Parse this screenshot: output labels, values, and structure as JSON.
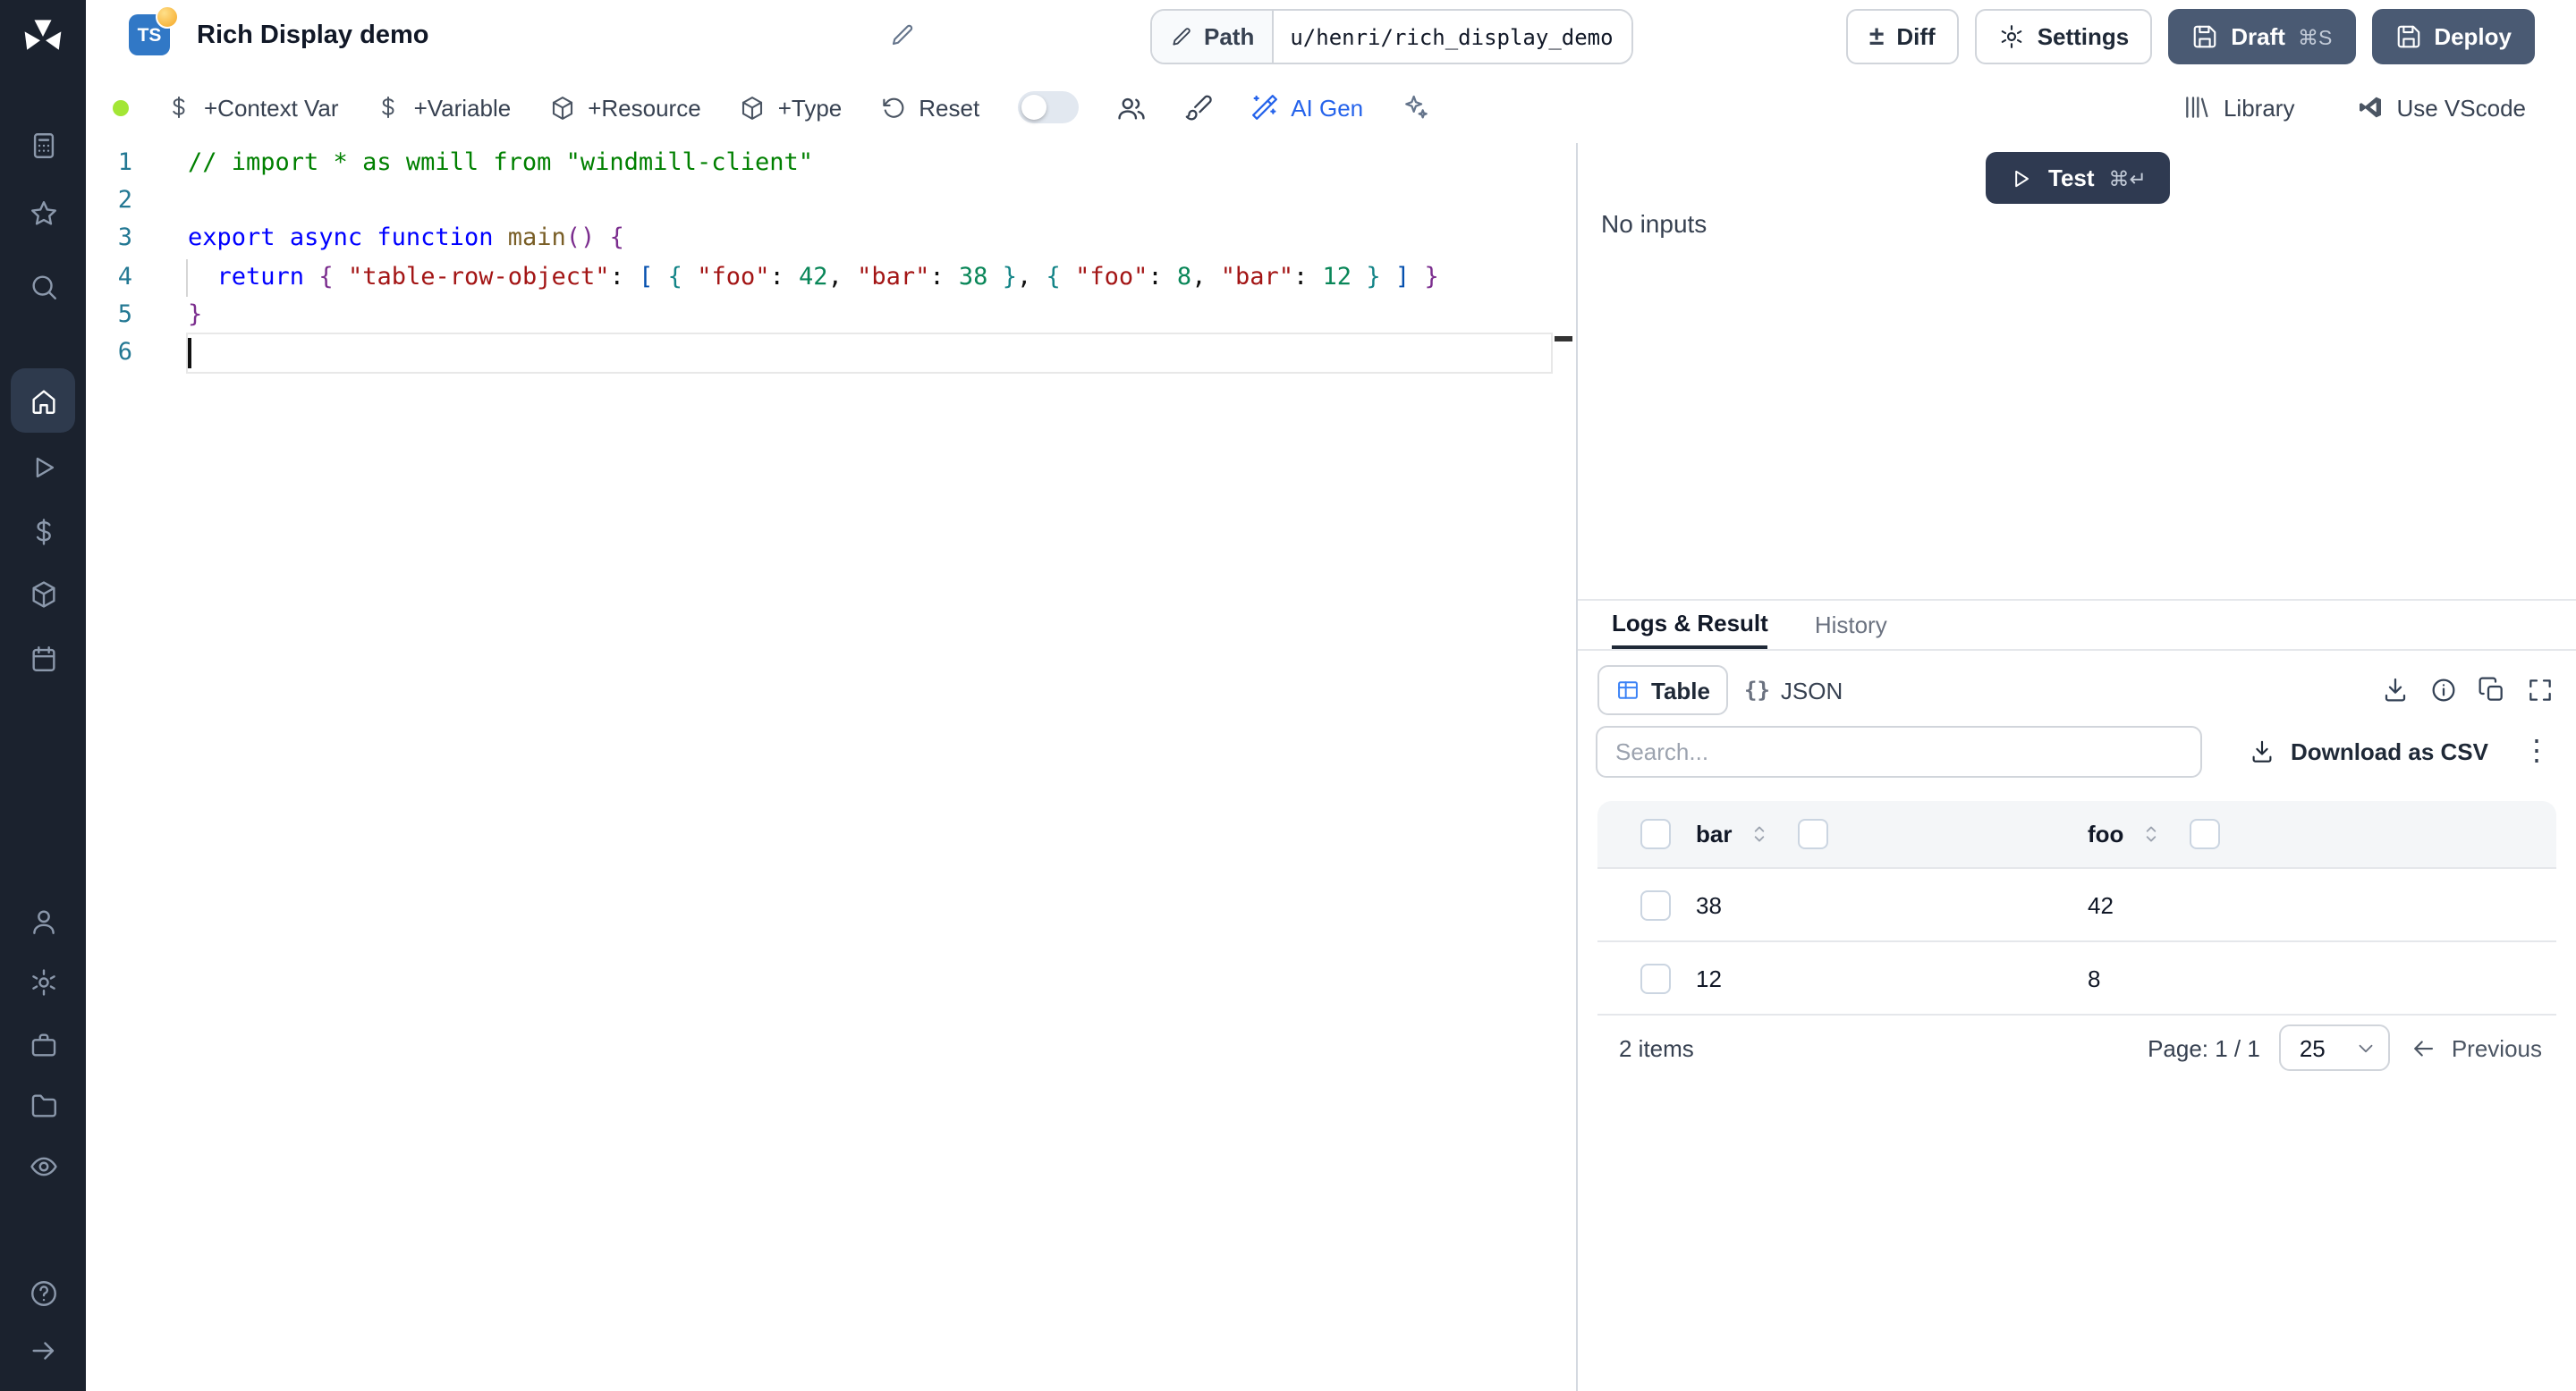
{
  "sidebar": {
    "active_item": "home",
    "icons": [
      "windmill-logo",
      "calculator",
      "star",
      "search",
      "home",
      "play",
      "dollar",
      "boxes",
      "calendar",
      "user",
      "settings",
      "briefcase",
      "folder",
      "eye",
      "help",
      "collapse-arrow"
    ]
  },
  "header": {
    "badge": "TS",
    "title": "Rich Display demo",
    "path_label": "Path",
    "path_value": "u/henri/rich_display_demo",
    "diff_label": "Diff",
    "diff_glyph": "±",
    "settings_label": "Settings",
    "draft_label": "Draft",
    "draft_shortcut": "⌘S",
    "deploy_label": "Deploy"
  },
  "toolbar": {
    "context_var_label": "+Context Var",
    "variable_label": "+Variable",
    "resource_label": "+Resource",
    "type_label": "+Type",
    "reset_label": "Reset",
    "ai_gen_label": "AI Gen",
    "library_label": "Library",
    "vscode_label": "Use VScode"
  },
  "editor": {
    "lines": [
      {
        "num": "1",
        "segments": [
          {
            "c": "comment",
            "t": "// import * as wmill from \"windmill-client\""
          }
        ]
      },
      {
        "num": "2",
        "segments": []
      },
      {
        "num": "3",
        "segments": [
          {
            "c": "kw",
            "t": "export"
          },
          {
            "c": "plain",
            "t": " "
          },
          {
            "c": "kw",
            "t": "async"
          },
          {
            "c": "plain",
            "t": " "
          },
          {
            "c": "kw",
            "t": "function"
          },
          {
            "c": "plain",
            "t": " "
          },
          {
            "c": "fn",
            "t": "main"
          },
          {
            "c": "b1",
            "t": "()"
          },
          {
            "c": "plain",
            "t": " "
          },
          {
            "c": "b1",
            "t": "{"
          }
        ]
      },
      {
        "num": "4",
        "guide": true,
        "segments": [
          {
            "c": "plain",
            "t": "  "
          },
          {
            "c": "kw",
            "t": "return"
          },
          {
            "c": "plain",
            "t": " "
          },
          {
            "c": "b1",
            "t": "{"
          },
          {
            "c": "plain",
            "t": " "
          },
          {
            "c": "str",
            "t": "\"table-row-object\""
          },
          {
            "c": "plain",
            "t": ": "
          },
          {
            "c": "b2",
            "t": "["
          },
          {
            "c": "plain",
            "t": " "
          },
          {
            "c": "b3",
            "t": "{"
          },
          {
            "c": "plain",
            "t": " "
          },
          {
            "c": "str",
            "t": "\"foo\""
          },
          {
            "c": "plain",
            "t": ": "
          },
          {
            "c": "num",
            "t": "42"
          },
          {
            "c": "plain",
            "t": ", "
          },
          {
            "c": "str",
            "t": "\"bar\""
          },
          {
            "c": "plain",
            "t": ": "
          },
          {
            "c": "num",
            "t": "38"
          },
          {
            "c": "plain",
            "t": " "
          },
          {
            "c": "b3",
            "t": "}"
          },
          {
            "c": "plain",
            "t": ", "
          },
          {
            "c": "b3",
            "t": "{"
          },
          {
            "c": "plain",
            "t": " "
          },
          {
            "c": "str",
            "t": "\"foo\""
          },
          {
            "c": "plain",
            "t": ": "
          },
          {
            "c": "num",
            "t": "8"
          },
          {
            "c": "plain",
            "t": ", "
          },
          {
            "c": "str",
            "t": "\"bar\""
          },
          {
            "c": "plain",
            "t": ": "
          },
          {
            "c": "num",
            "t": "12"
          },
          {
            "c": "plain",
            "t": " "
          },
          {
            "c": "b3",
            "t": "}"
          },
          {
            "c": "plain",
            "t": " "
          },
          {
            "c": "b2",
            "t": "]"
          },
          {
            "c": "plain",
            "t": " "
          },
          {
            "c": "b1",
            "t": "}"
          }
        ]
      },
      {
        "num": "5",
        "segments": [
          {
            "c": "b1",
            "t": "}"
          }
        ]
      },
      {
        "num": "6",
        "current": true,
        "segments": []
      }
    ]
  },
  "runner": {
    "test_label": "Test",
    "test_shortcut": "⌘↵",
    "no_inputs": "No inputs"
  },
  "result_panel": {
    "tab_logs": "Logs & Result",
    "tab_history": "History",
    "view_table": "Table",
    "view_json": "JSON",
    "json_glyph": "{}",
    "search_placeholder": "Search...",
    "download_csv_label": "Download as CSV",
    "kebab_glyph": "⋮",
    "table": {
      "columns": [
        "bar",
        "foo"
      ],
      "rows": [
        [
          "38",
          "42"
        ],
        [
          "12",
          "8"
        ]
      ],
      "items_label": "2 items",
      "page_label": "Page: 1 / 1",
      "page_size": "25",
      "previous_label": "Previous"
    }
  },
  "colors": {
    "sidebar_bg": "#1b222e",
    "accent_blue": "#2563eb",
    "dark_button": "#4a5a73",
    "test_button": "#2f3a51",
    "status_green": "#a3e635",
    "ts_badge": "#3178c6"
  }
}
